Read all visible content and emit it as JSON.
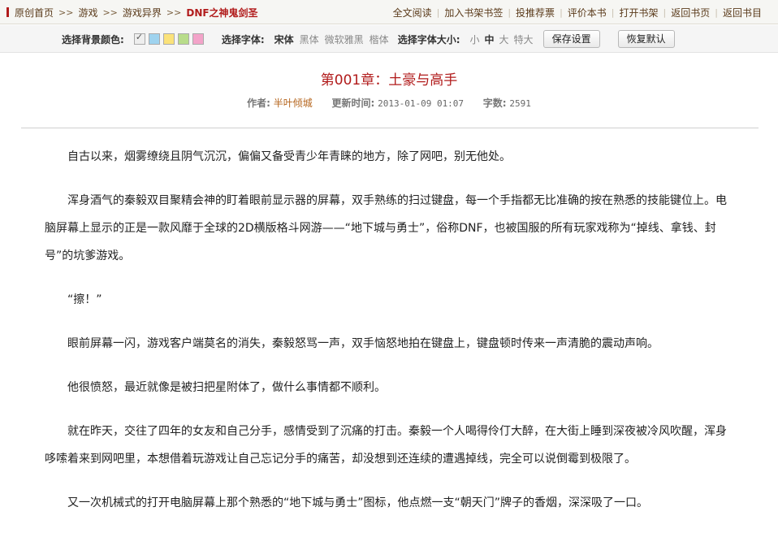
{
  "breadcrumb": {
    "items": [
      "原创首页",
      "游戏",
      "游戏异界"
    ],
    "separator": ">>",
    "current": "DNF之神鬼剑圣"
  },
  "toplinks": [
    "全文阅读",
    "加入书架书签",
    "投推荐票",
    "评价本书",
    "打开书架",
    "返回书页",
    "返回书目"
  ],
  "settings": {
    "bg_label": "选择背景颜色:",
    "bg_colors": [
      "#eeeeee",
      "#9fd3ef",
      "#fbe27a",
      "#b8dc8a",
      "#f3a3c9"
    ],
    "font_label": "选择字体:",
    "fonts": [
      "宋体",
      "黑体",
      "微软雅黑",
      "楷体"
    ],
    "size_label": "选择字体大小:",
    "sizes": [
      "小",
      "中",
      "大",
      "特大"
    ],
    "save_label": "保存设置",
    "reset_label": "恢复默认"
  },
  "chapter": {
    "title": "第001章：土豪与高手",
    "author_label": "作者:",
    "author": "半叶倾城",
    "update_label": "更新时间:",
    "update": "2013-01-09 01:07",
    "words_label": "字数:",
    "words": "2591"
  },
  "paragraphs": [
    "自古以来，烟雾缭绕且阴气沉沉，偏偏又备受青少年青睐的地方，除了网吧，别无他处。",
    "浑身酒气的秦毅双目聚精会神的盯着眼前显示器的屏幕，双手熟练的扫过键盘，每一个手指都无比准确的按在熟悉的技能键位上。电脑屏幕上显示的正是一款风靡于全球的2D横版格斗网游——“地下城与勇士”，俗称DNF，也被国服的所有玩家戏称为“掉线、拿钱、封号”的坑爹游戏。",
    "“擦！”",
    "眼前屏幕一闪，游戏客户端莫名的消失，秦毅怒骂一声，双手恼怒地拍在键盘上，键盘顿时传来一声清脆的震动声响。",
    "他很愤怒，最近就像是被扫把星附体了，做什么事情都不顺利。",
    "就在昨天，交往了四年的女友和自己分手，感情受到了沉痛的打击。秦毅一个人喝得伶仃大醉，在大街上睡到深夜被冷风吹醒，浑身哆嗦着来到网吧里，本想借着玩游戏让自己忘记分手的痛苦，却没想到还连续的遭遇掉线，完全可以说倒霉到极限了。",
    "又一次机械式的打开电脑屏幕上那个熟悉的“地下城与勇士”图标，他点燃一支“朝天门”牌子的香烟，深深吸了一口。"
  ]
}
